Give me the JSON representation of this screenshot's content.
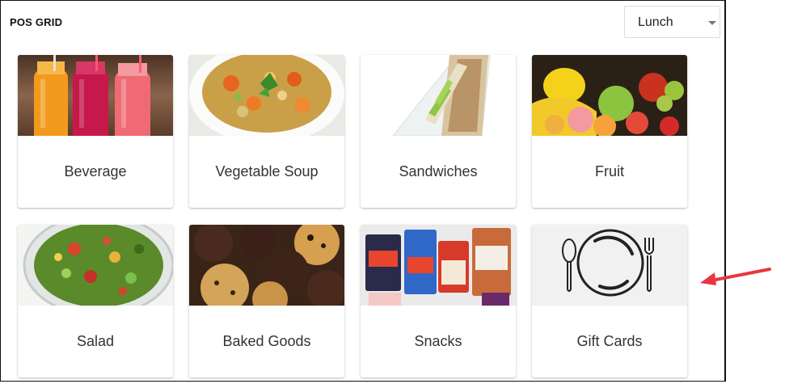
{
  "header": {
    "title": "POS GRID"
  },
  "meal_select": {
    "selected": "Lunch"
  },
  "categories": [
    {
      "label": "Beverage",
      "icon": "beverage-photo"
    },
    {
      "label": "Vegetable Soup",
      "icon": "vegetable-soup-photo"
    },
    {
      "label": "Sandwiches",
      "icon": "sandwich-photo"
    },
    {
      "label": "Fruit",
      "icon": "fruit-photo"
    },
    {
      "label": "Salad",
      "icon": "salad-photo"
    },
    {
      "label": "Baked Goods",
      "icon": "muffins-photo"
    },
    {
      "label": "Snacks",
      "icon": "snacks-photo"
    },
    {
      "label": "Gift Cards",
      "icon": "plate-cutlery-icon"
    }
  ],
  "colors": {
    "annotation_arrow": "#e8373f",
    "card_text": "#333333",
    "gift_card_bg": "#f1f1f1"
  }
}
